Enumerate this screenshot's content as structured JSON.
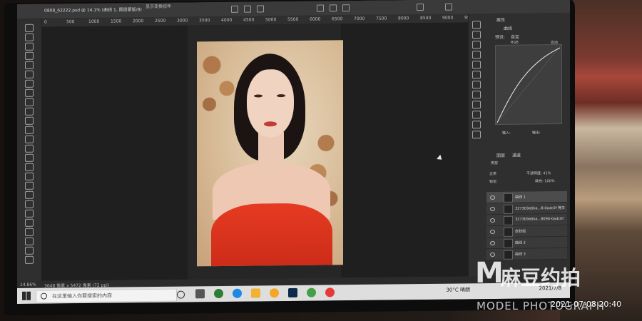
{
  "document": {
    "tab_title": "0808_62222.psd @ 14.1% (曲线 1, 图层蒙版/8)",
    "zoom": "14.86%",
    "doc_size": "3648 像素 x 5472 像素 (72 ppi)"
  },
  "options_bar": {
    "text": "显示变换控件"
  },
  "ruler": {
    "ticks": [
      "0",
      "500",
      "1000",
      "1500",
      "2000",
      "2500",
      "3000",
      "3500",
      "4000",
      "4500",
      "5000",
      "5500",
      "6000",
      "6500",
      "7000",
      "7500",
      "8000",
      "8500",
      "9000",
      "9500"
    ]
  },
  "panels": {
    "properties_title": "属性",
    "properties_sub": "曲线",
    "preset_label": "预设:",
    "preset_value": "自定",
    "channel_value": "RGB",
    "auto_label": "自动",
    "input_label": "输入:",
    "output_label": "输出:",
    "layers_tabs": [
      "图层",
      "通道"
    ],
    "filter_kind": "类型",
    "blend_mode": "正常",
    "opacity_label": "不透明度: 41%",
    "lock_label": "锁定:",
    "fill_label": "填充: 100%",
    "layers": [
      {
        "name": "曲线 1",
        "selected": true
      },
      {
        "name": "3273b9e6ba...8-0adc0f 拷贝",
        "selected": false
      },
      {
        "name": "3273b9e6ba...8090-0adc0f",
        "selected": false
      },
      {
        "name": "皮肤组",
        "selected": false
      },
      {
        "name": "曲线 2",
        "selected": false
      },
      {
        "name": "曲线 3",
        "selected": false
      }
    ]
  },
  "taskbar": {
    "search_placeholder": "在这里输入你要搜索的内容",
    "weather": "30°C 晴朗",
    "clock_date": "2021/7/8"
  },
  "watermark": {
    "logo_letter": "M",
    "logo_cn": "麻豆约拍",
    "logo_en": "MODEL PHOTOGRAPH"
  },
  "datestamp": "2021-07-08 20:40"
}
